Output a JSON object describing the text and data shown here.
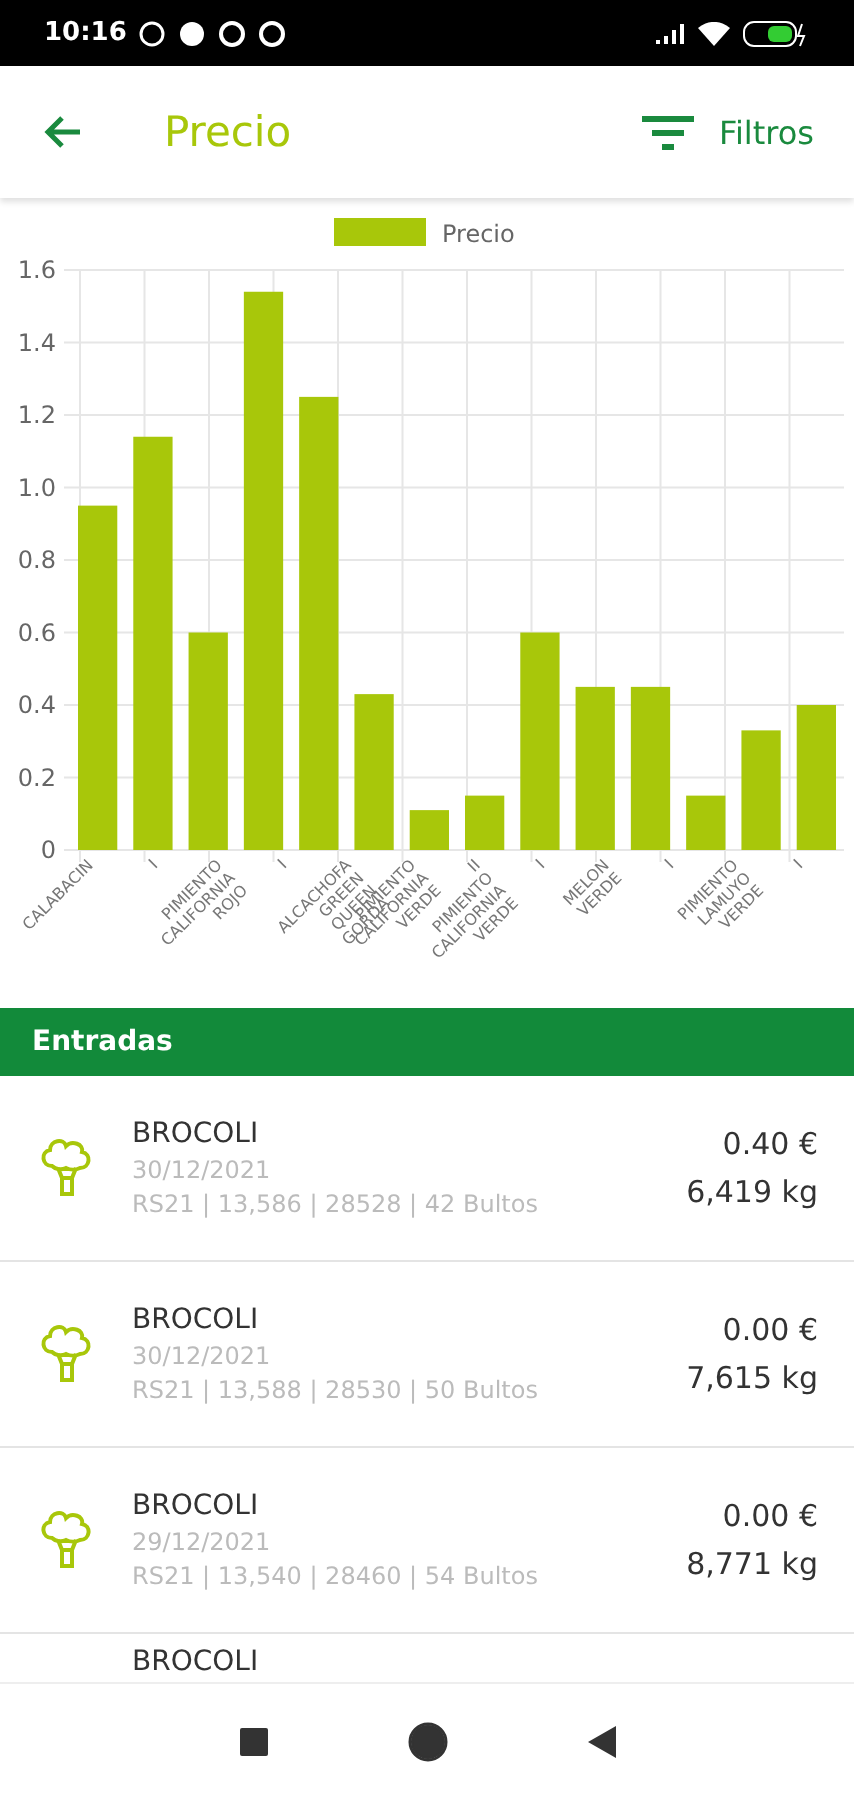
{
  "status_bar": {
    "time": "10:16"
  },
  "header": {
    "title": "Precio",
    "filter_label": "Filtros"
  },
  "chart": {
    "chart_data": {
      "type": "bar",
      "series": [
        {
          "name": "Precio",
          "color": "#a8c70a",
          "values": [
            0.95,
            1.14,
            0.6,
            1.54,
            1.25,
            0.43,
            0.11,
            0.15,
            0.6,
            0.45,
            0.45,
            0.15,
            0.33,
            0.4
          ]
        }
      ],
      "ylim": [
        0,
        1.6
      ],
      "grid": true,
      "yticks": [
        0,
        0.2,
        0.4,
        0.6,
        0.8,
        {
          "value": 1,
          "label": "1.0"
        },
        1.2,
        1.4,
        1.6
      ]
    },
    "x_labels": [
      {
        "lines": [
          "CALABACIN"
        ]
      },
      {
        "lines": [
          "I"
        ]
      },
      {
        "lines": [
          "PIMIENTO",
          "CALIFORNIA",
          "ROJO"
        ]
      },
      {
        "lines": [
          "I"
        ]
      },
      {
        "lines": [
          "ALCACHOFA",
          "GREEN",
          "QUEEN",
          "GORDA"
        ]
      },
      {
        "lines": [
          "PIMIENTO",
          "CALIFORNIA",
          "VERDE"
        ]
      },
      {
        "lines": [
          "II",
          "PIMIENTO",
          "CALIFORNIA",
          "VERDE"
        ]
      },
      {
        "lines": [
          "I"
        ]
      },
      {
        "lines": [
          "MELON",
          "VERDE"
        ]
      },
      {
        "lines": [
          "I"
        ]
      },
      {
        "lines": [
          "PIMIENTO",
          "LAMUYO",
          "VERDE"
        ]
      },
      {
        "lines": [
          "I"
        ]
      }
    ]
  },
  "section_title": "Entradas",
  "entries": [
    {
      "kind": "full",
      "name": "BROCOLI",
      "date": "30/12/2021",
      "details": "RS21 | 13,586 | 28528 | 42 Bultos",
      "price": "0.40 €",
      "weight": "6,419 kg"
    },
    {
      "kind": "full",
      "name": "BROCOLI",
      "date": "30/12/2021",
      "details": "RS21 | 13,588 | 28530 | 50 Bultos",
      "price": "0.00 €",
      "weight": "7,615 kg"
    },
    {
      "kind": "full",
      "name": "BROCOLI",
      "date": "29/12/2021",
      "details": "RS21 | 13,540 | 28460 | 54 Bultos",
      "price": "0.00 €",
      "weight": "8,771 kg"
    },
    {
      "kind": "partial",
      "name": "BROCOLI"
    }
  ]
}
